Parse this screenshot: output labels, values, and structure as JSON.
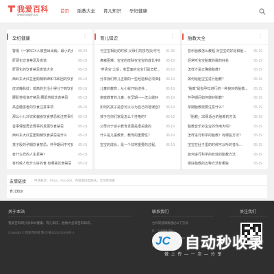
{
  "header": {
    "logo_title": "我爱百科",
    "logo_url": "www.wajm.cn",
    "nav": [
      "首页",
      "胎教大全",
      "育儿知识",
      "孕妇健康"
    ]
  },
  "panels": [
    {
      "title": "孕妇健康",
      "rows": [
        {
          "title": "警惕（一家5口4人被查出出病，最小的女孩才...",
          "date": "05-24"
        },
        {
          "title": "肝硬化饮食禁忌及食谱",
          "date": "05-19"
        },
        {
          "title": "肝硬化的饮食禁忌食谱大全",
          "date": "05-19"
        },
        {
          "title": "西岭东大红豆团购精新碑和书和团的饮食禁忌...",
          "date": "05-19"
        },
        {
          "title": "皮切静脉纹：孤高的主活小得分下到饮食禁忌...",
          "date": "05-19"
        },
        {
          "title": "腰肌劳损食疗禁忌 腰肌劳损饮食禁忌",
          "date": "05-19"
        },
        {
          "title": "高血糖患者的饮食注意事项",
          "date": "05-19"
        },
        {
          "title": "那么小儿冷饮和偏食饮食禁忌和注意事项",
          "date": "05-19"
        },
        {
          "title": "善事保健再去赛事的发展饮食禁忌",
          "date": "05-19"
        },
        {
          "title": "西岭东大红豆团购精饮食禁忌是什么",
          "date": "05-19"
        },
        {
          "title": "孩子股的孕期饮食禁忌，怀孕期间不可妄可...",
          "date": "05-19"
        },
        {
          "title": "有什么样的人生素等？",
          "date": "05-19"
        },
        {
          "title": "有时候人吃什么好的食 有哪些饮食禁忌",
          "date": "05-19"
        }
      ]
    },
    {
      "title": "育儿知识",
      "rows": [
        {
          "title": "与宝宝相处的时候 父母们的技巧(比可与...",
          "date": "01-06"
        },
        {
          "title": "鼻塞困难：宝宝的皮肤在宝宝的成长中的...",
          "date": "05-19"
        },
        {
          "title": "“养贵宝”之后，家里面的宝宝们是怎样...",
          "date": "05-19"
        },
        {
          "title": "分享我们育儿正期的一些经验和必须准备",
          "date": "05-19"
        },
        {
          "title": "儿童的教育，从小就开始培养...",
          "date": "05-19"
        },
        {
          "title": "家庭教育的儿童，在早期——怎么做好（实...",
          "date": "05-19"
        },
        {
          "title": "如何的孩子是否可以以为自己的错误自行处...",
          "date": "05-19"
        },
        {
          "title": "孩子在你们家是怎么个性格的？",
          "date": "05-19"
        },
        {
          "title": "父母对于孩子教育发展是很关键的",
          "date": "05-19"
        },
        {
          "title": "什么是儿童教育，教育的重要性？",
          "date": "05-19"
        },
        {
          "title": "宝宝的成长，是一个非常重要的过程。",
          "date": "05-19"
        }
      ]
    },
    {
      "title": "胎教大全",
      "rows": [
        {
          "title": "音乐胎教怎么教程 对宝宝的好处和胎...",
          "date": "05-19"
        },
        {
          "title": "经常听宝宝胎教的歌的好处",
          "date": "05-19"
        },
        {
          "title": "怎样才是正确做胎教？",
          "date": "05-19"
        },
        {
          "title": "如何给胎宝宝进行胎教？",
          "date": "05-19"
        },
        {
          "title": "“胎教”是指孕妇进行的一种良好的胎教...",
          "date": "05-19"
        },
        {
          "title": "怀孕期间如何做好胎教？",
          "date": "05-19"
        },
        {
          "title": "孕期胎教需要注意什么？",
          "date": "05-19"
        },
        {
          "title": "「胎教」30周适合的胎教的方法",
          "date": "05-19"
        },
        {
          "title": "胎教音乐对宝宝的作用大吗？",
          "date": "05-19"
        },
        {
          "title": "怎样进行科学的胎教？有哪些方法？",
          "date": "05-19"
        },
        {
          "title": "宝宝在肚子里的时候可以听的音乐...",
          "date": "05-19"
        },
        {
          "title": "如何进行科学的有效的胎教方法",
          "date": "05-19"
        },
        {
          "title": "做好胎教的五种方法有哪些",
          "date": "05-19"
        }
      ]
    }
  ],
  "links": {
    "title": "友情链接",
    "requirement": "申请要求：PR≥3，IP≥1000，内容需同类网站，无作弊现象",
    "items": [
      "育儿知识"
    ]
  },
  "footer": {
    "about_title": "关于本站",
    "about_desc": "我爱百科网分享孕妇健康，育儿知识，胎教大全等百科知识。",
    "copyright": "Copyright © 我爱百科网  豫ICP备2022012345号-1",
    "contact_title": "联系我们",
    "contact_lines": [
      "合作或投稿请通过以下方式",
      "Q：123456789",
      "E：123456789@qq.com",
      "周一至周五 9:00-18:00"
    ],
    "follow_title": "关注我们"
  },
  "watermark": {
    "badge": "JC",
    "main": "自动秒收录",
    "sub": "做 上 传 — 一 次 — 分 享"
  },
  "colors": {
    "accent": "#e8554e",
    "footer_bg": "#2f2f2f",
    "page_bg": "#f1f1f1"
  }
}
